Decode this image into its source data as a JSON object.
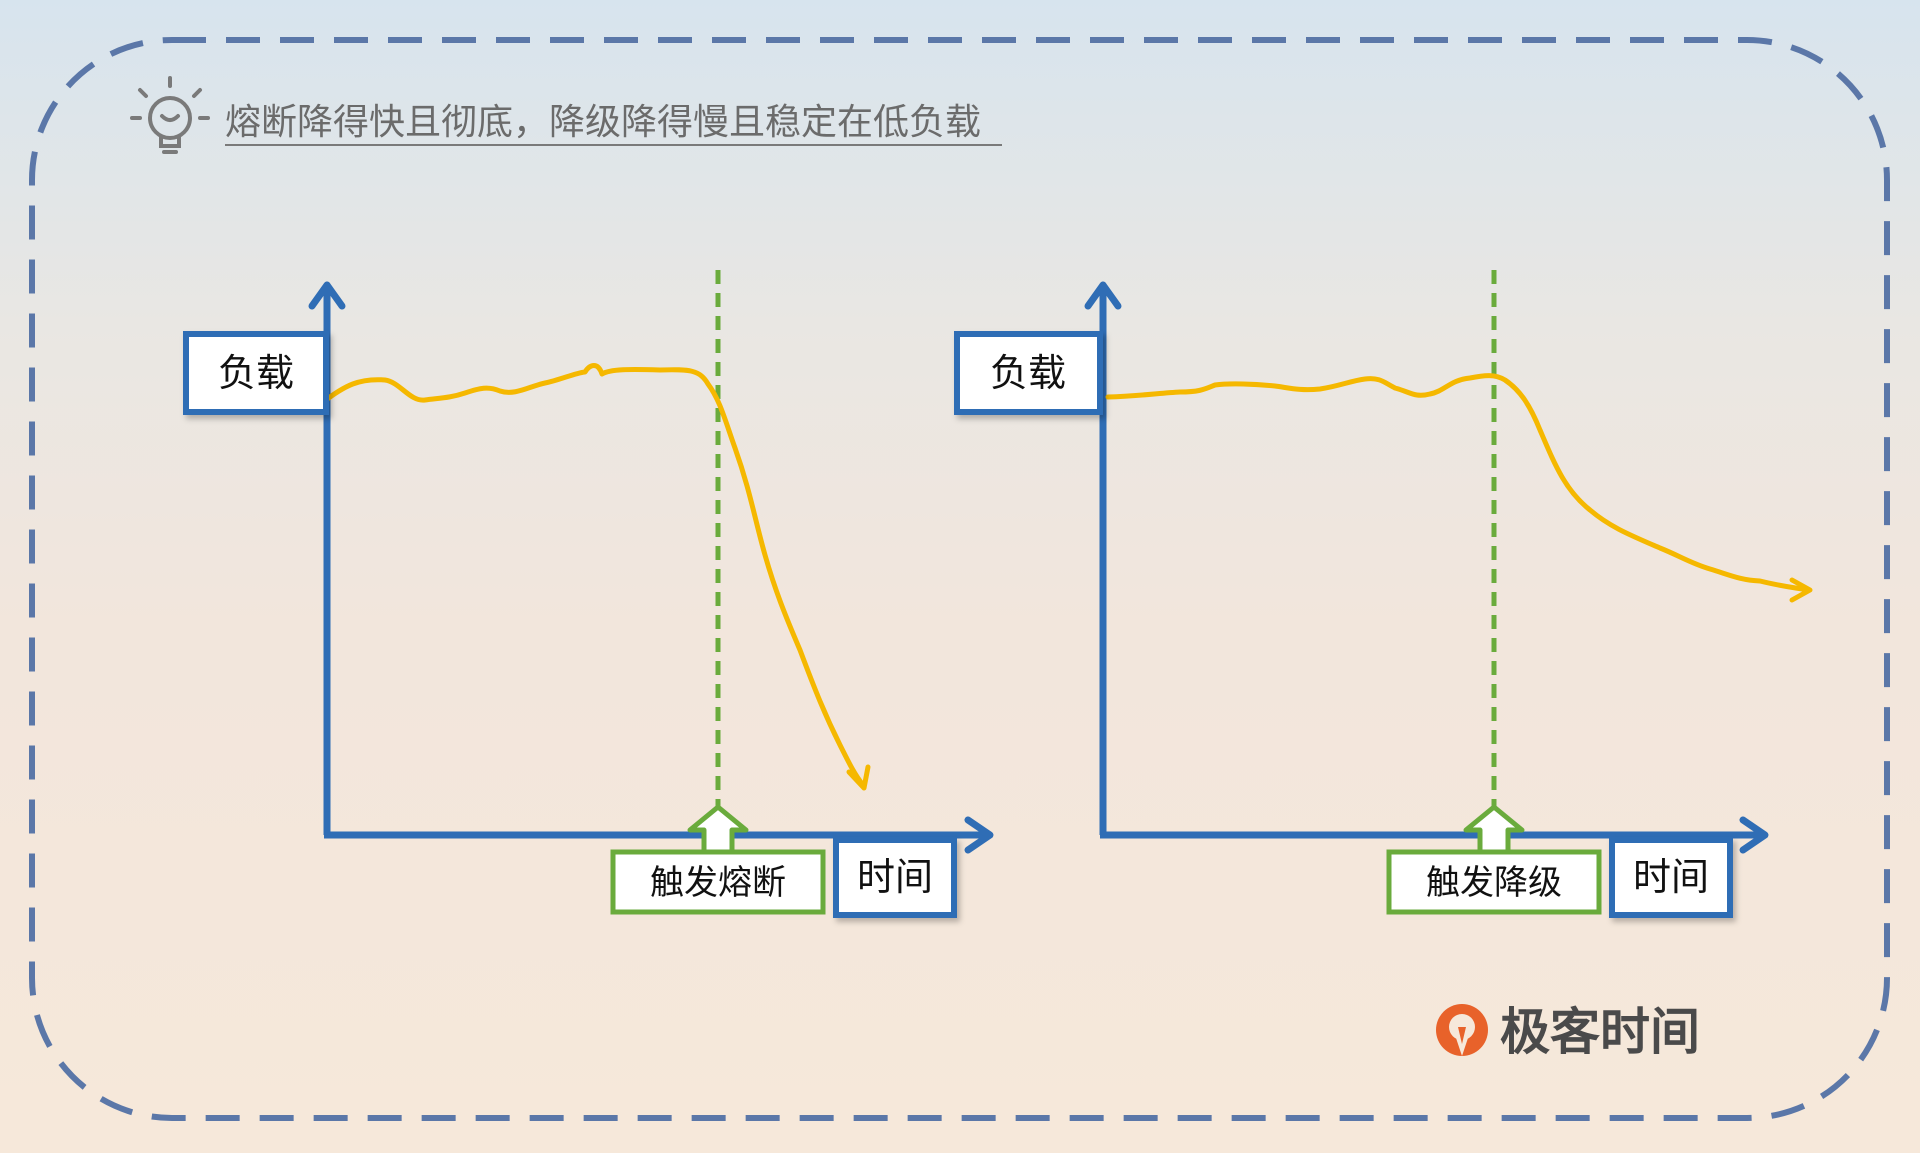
{
  "title": "熔断降得快且彻底，降级降得慢且稳定在低负载",
  "colors": {
    "frame": "#5b77a8",
    "axis": "#2f6db5",
    "curve": "#f5b800",
    "trigger": "#6aab3c",
    "box_fill": "#ffffff",
    "logo_orange": "#e8622a"
  },
  "left_chart": {
    "y_label": "负载",
    "x_label": "时间",
    "trigger_label": "触发熔断"
  },
  "right_chart": {
    "y_label": "负载",
    "x_label": "时间",
    "trigger_label": "触发降级"
  },
  "logo": {
    "text": "极客时间",
    "icon": "geektime-logo-icon"
  },
  "title_icon": "lightbulb-icon"
}
